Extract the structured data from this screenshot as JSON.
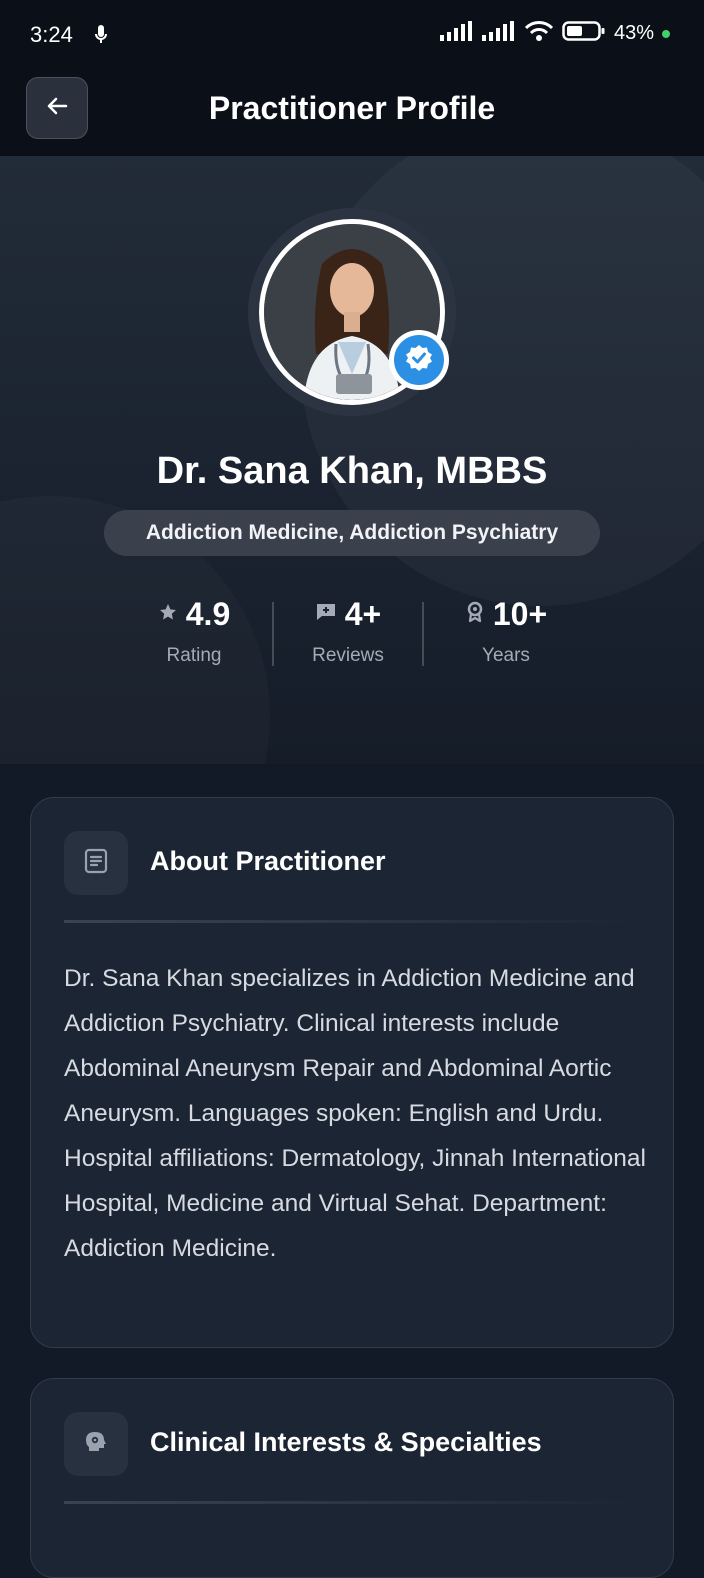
{
  "status_bar": {
    "time": "3:24",
    "battery": "43%",
    "icons": [
      "mic-icon",
      "signal-icon",
      "signal-icon",
      "wifi-icon",
      "battery-icon"
    ]
  },
  "app_bar": {
    "title": "Practitioner Profile",
    "back_icon": "arrow-left-icon"
  },
  "profile": {
    "name": "Dr. Sana Khan, MBBS",
    "specialty": "Addiction Medicine, Addiction Psychiatry",
    "verified": true
  },
  "stats": [
    {
      "icon": "star-icon",
      "value": "4.9",
      "label": "Rating"
    },
    {
      "icon": "review-icon",
      "value": "4+",
      "label": "Reviews"
    },
    {
      "icon": "award-icon",
      "value": "10+",
      "label": "Years"
    }
  ],
  "about": {
    "title": "About Practitioner",
    "icon": "document-icon",
    "text": "Dr. Sana Khan specializes in Addiction Medicine and Addiction Psychiatry. Clinical interests include Abdominal Aneurysm Repair and Abdominal Aortic Aneurysm. Languages spoken: English and Urdu. Hospital affiliations: Dermatology, Jinnah International Hospital, Medicine and Virtual Sehat. Department: Addiction Medicine."
  },
  "clinical": {
    "title": "Clinical Interests & Specialties",
    "icon": "brain-icon"
  },
  "colors": {
    "background": "#111a26",
    "card": "#1c2533",
    "accent_verified": "#2b8fe3",
    "battery_dot": "#3fd16b"
  }
}
